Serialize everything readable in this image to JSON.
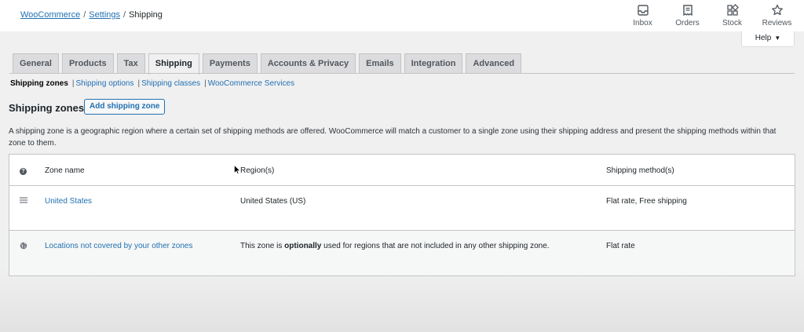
{
  "breadcrumb": {
    "items": [
      "WooCommerce",
      "Settings"
    ],
    "separator": "/",
    "current": "Shipping"
  },
  "header_actions": [
    {
      "label": "Inbox",
      "icon": "inbox-icon"
    },
    {
      "label": "Orders",
      "icon": "orders-icon"
    },
    {
      "label": "Stock",
      "icon": "stock-icon"
    },
    {
      "label": "Reviews",
      "icon": "star-icon"
    }
  ],
  "help": {
    "label": "Help",
    "icon": "caret-down-icon"
  },
  "tabs": [
    {
      "label": "General"
    },
    {
      "label": "Products"
    },
    {
      "label": "Tax"
    },
    {
      "label": "Shipping",
      "active": true
    },
    {
      "label": "Payments"
    },
    {
      "label": "Accounts & Privacy"
    },
    {
      "label": "Emails"
    },
    {
      "label": "Integration"
    },
    {
      "label": "Advanced"
    }
  ],
  "subnav": {
    "current": "Shipping zones",
    "links": [
      "Shipping options",
      "Shipping classes",
      "WooCommerce Services"
    ],
    "separator": "|"
  },
  "page": {
    "title": "Shipping zones",
    "add_button": "Add shipping zone",
    "description": "A shipping zone is a geographic region where a certain set of shipping methods are offered. WooCommerce will match a customer to a single zone using their shipping address and present the shipping methods within that zone to them."
  },
  "table": {
    "columns": {
      "zone_name": "Zone name",
      "regions": "Region(s)",
      "methods": "Shipping method(s)"
    },
    "rows": [
      {
        "name": "United States",
        "region": "United States (US)",
        "methods": "Flat rate, Free shipping",
        "icon": "drag-handle-icon"
      }
    ],
    "fallback": {
      "name": "Locations not covered by your other zones",
      "region_pre": "This zone is ",
      "region_bold": "optionally",
      "region_post": " used for regions that are not included in any other shipping zone.",
      "methods": "Flat rate",
      "icon": "globe-icon"
    }
  },
  "colors": {
    "link": "#2271b1",
    "text": "#1d2327",
    "tab_bg": "#dcdcde",
    "page_bg": "#f0f0f1"
  }
}
